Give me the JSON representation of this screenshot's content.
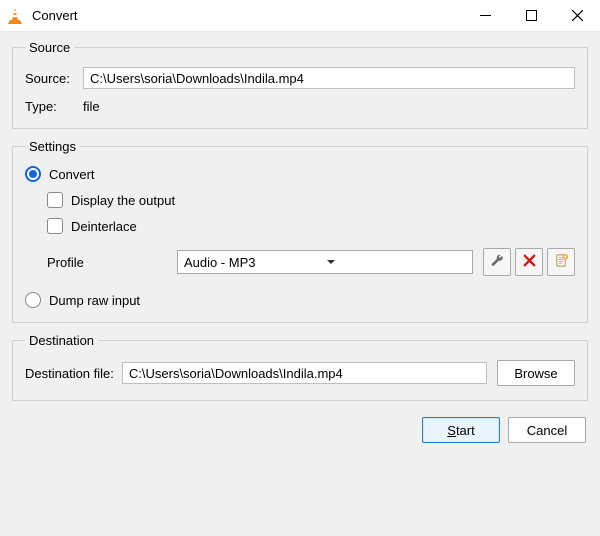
{
  "window": {
    "title": "Convert"
  },
  "source": {
    "legend": "Source",
    "source_label": "Source:",
    "source_value": "C:\\Users\\soria\\Downloads\\Indila.mp4",
    "type_label": "Type:",
    "type_value": "file"
  },
  "settings": {
    "legend": "Settings",
    "convert_label": "Convert",
    "display_output_label": "Display the output",
    "deinterlace_label": "Deinterlace",
    "profile_label": "Profile",
    "profile_value": "Audio - MP3",
    "dump_raw_label": "Dump raw input"
  },
  "destination": {
    "legend": "Destination",
    "file_label": "Destination file:",
    "file_value": "C:\\Users\\soria\\Downloads\\Indila.mp4",
    "browse_label": "Browse"
  },
  "footer": {
    "start_label": "Start",
    "cancel_label": "Cancel"
  }
}
